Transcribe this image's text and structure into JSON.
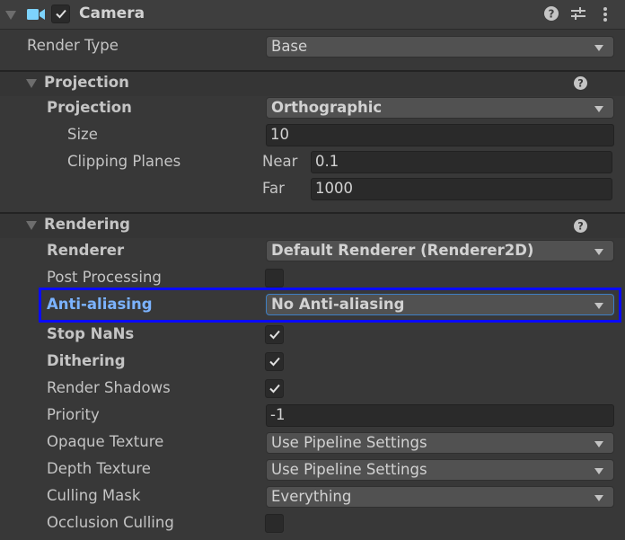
{
  "component": {
    "title": "Camera",
    "enabled": true,
    "icons": [
      "camera-icon",
      "help-icon",
      "preset-icon",
      "more-options-icon"
    ]
  },
  "render_type": {
    "label": "Render Type",
    "value": "Base"
  },
  "projection_section": {
    "title": "Projection",
    "projection": {
      "label": "Projection",
      "value": "Orthographic"
    },
    "size": {
      "label": "Size",
      "value": "10"
    },
    "clipping_planes": {
      "label": "Clipping Planes",
      "near_label": "Near",
      "near_value": "0.1",
      "far_label": "Far",
      "far_value": "1000"
    }
  },
  "rendering_section": {
    "title": "Rendering",
    "renderer": {
      "label": "Renderer",
      "value": "Default Renderer (Renderer2D)"
    },
    "post_processing": {
      "label": "Post Processing",
      "checked": false
    },
    "anti_aliasing": {
      "label": "Anti-aliasing",
      "value": "No Anti-aliasing"
    },
    "stop_nans": {
      "label": "Stop NaNs",
      "checked": true
    },
    "dithering": {
      "label": "Dithering",
      "checked": true
    },
    "render_shadows": {
      "label": "Render Shadows",
      "checked": true
    },
    "priority": {
      "label": "Priority",
      "value": "-1"
    },
    "opaque_texture": {
      "label": "Opaque Texture",
      "value": "Use Pipeline Settings"
    },
    "depth_texture": {
      "label": "Depth Texture",
      "value": "Use Pipeline Settings"
    },
    "culling_mask": {
      "label": "Culling Mask",
      "value": "Everything"
    },
    "occlusion_culling": {
      "label": "Occlusion Culling",
      "checked": false
    }
  },
  "colors": {
    "highlight_border": "#0a0aff",
    "highlight_label": "#7bb3ff",
    "camera_icon": "#7dd3fc"
  }
}
